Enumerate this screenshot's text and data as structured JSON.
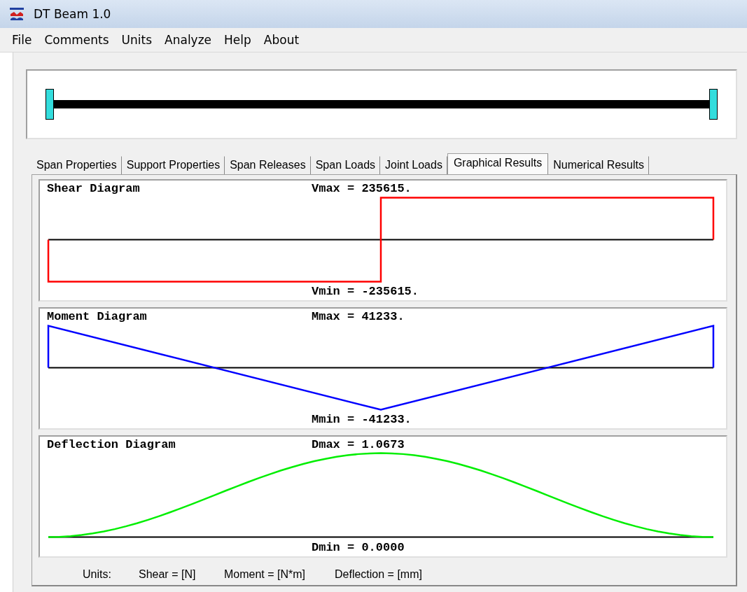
{
  "window": {
    "title": "DT Beam  1.0"
  },
  "menu": [
    "File",
    "Comments",
    "Units",
    "Analyze",
    "Help",
    "About"
  ],
  "tabs": [
    {
      "label": "Span Properties",
      "selected": false
    },
    {
      "label": "Support Properties",
      "selected": false
    },
    {
      "label": "Span Releases",
      "selected": false
    },
    {
      "label": "Span Loads",
      "selected": false
    },
    {
      "label": "Joint Loads",
      "selected": false
    },
    {
      "label": "Graphical Results",
      "selected": true
    },
    {
      "label": "Numerical Results",
      "selected": false
    }
  ],
  "diagrams": [
    {
      "kind": "shear",
      "title": "Shear Diagram",
      "max": "Vmax = 235615.",
      "min": "Vmin = -235615.",
      "color": "#ff0000"
    },
    {
      "kind": "moment",
      "title": "Moment Diagram",
      "max": "Mmax = 41233.",
      "min": "Mmin = -41233.",
      "color": "#0000ff"
    },
    {
      "kind": "deflection",
      "title": "Deflection Diagram",
      "max": "Dmax = 1.0673",
      "min": "Dmin = 0.0000",
      "color": "#00ee00"
    }
  ],
  "units": [
    "Units:",
    "Shear = [N]",
    "Moment = [N*m]",
    "Deflection = [mm]"
  ]
}
